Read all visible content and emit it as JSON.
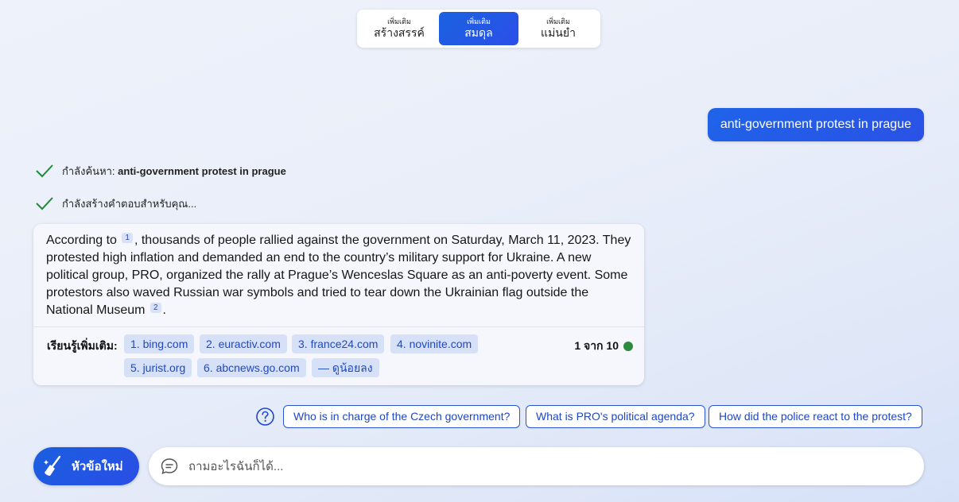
{
  "tone": {
    "options": [
      {
        "small": "เพิ่มเติม",
        "label": "สร้างสรรค์"
      },
      {
        "small": "เพิ่มเติม",
        "label": "สมดุล"
      },
      {
        "small": "เพิ่มเติม",
        "label": "แม่นยำ"
      }
    ],
    "selected": "สมดุล"
  },
  "user_message": "anti-government protest in prague",
  "status": {
    "searching_prefix": "กำลังค้นหา: ",
    "searching_query": "anti-government protest in prague",
    "generating": "กำลังสร้างคำตอบสำหรับคุณ..."
  },
  "answer": {
    "part1": "According to",
    "cite1": "1",
    "part2": ", thousands of people rallied against the government on Saturday, March 11, 2023. They protested high inflation and demanded an end to the country’s military support for Ukraine. A new political group, PRO, organized the rally at Prague’s Wenceslas Square as an anti-poverty event. Some protestors also waved Russian war symbols and tried to tear down the Ukrainian flag outside the National Museum",
    "cite2": "2",
    "part3": "."
  },
  "learn_more": {
    "label": "เรียนรู้เพิ่มเติม:",
    "sources": [
      "1. bing.com",
      "2. euractiv.com",
      "3. france24.com",
      "4. novinite.com",
      "5. jurist.org",
      "6. abcnews.go.com"
    ],
    "show_less": "— ดูน้อยลง",
    "counter": "1 จาก 10",
    "status_color": "#2d8a3e"
  },
  "suggestions": [
    "Who is in charge of the Czech government?",
    "What is PRO's political agenda?",
    "How did the police react to the protest?"
  ],
  "bottom": {
    "new_topic_label": "หัวข้อใหม่",
    "ask_placeholder": "ถามอะไรฉันก็ได้..."
  },
  "icons": {
    "new_topic": "broom-icon",
    "ask": "chat-bubble-icon",
    "help": "question-circle-icon",
    "status": "check-icon"
  },
  "colors": {
    "accent": "#2a52e6",
    "link": "#1d46c8",
    "check": "#1f8a3a"
  }
}
